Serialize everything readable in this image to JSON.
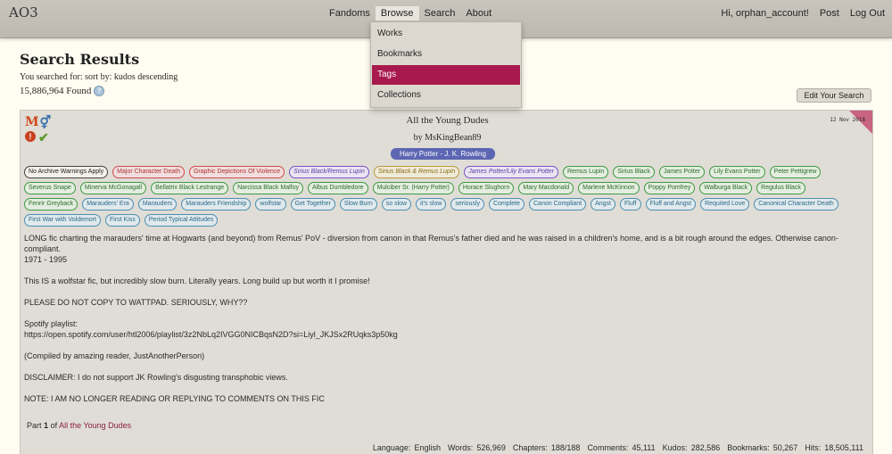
{
  "header": {
    "logo": "AO3",
    "nav": [
      "Fandoms",
      "Browse",
      "Search",
      "About"
    ],
    "user_nav": [
      "Hi, orphan_account!",
      "Post",
      "Log Out"
    ]
  },
  "browse_menu": [
    "Works",
    "Bookmarks",
    "Tags",
    "Collections"
  ],
  "search": {
    "title": "Search Results",
    "description": "You searched for: sort by: kudos descending",
    "found": "15,886,964 Found",
    "help": "?",
    "edit_button": "Edit Your Search"
  },
  "work": {
    "title": "All the Young Dudes",
    "byline": "by MsKingBean89",
    "fandom": "Harry Potter - J. K. Rowling",
    "date": "12 Nov 2018",
    "rating_symbols": [
      "M",
      "⚥",
      "!",
      "✔"
    ],
    "tags": [
      {
        "label": "No Archive Warnings Apply",
        "type": "warning"
      },
      {
        "label": "Major Character Death",
        "type": "category"
      },
      {
        "label": "Graphic Depictions Of Violence",
        "type": "category"
      },
      {
        "label": "Sirius Black/Remus Lupin",
        "type": "rel1"
      },
      {
        "label": "Sirius Black & Remus Lupin",
        "type": "rel2"
      },
      {
        "label": "James Potter/Lily Evans Potter",
        "type": "rel1"
      },
      {
        "label": "Remus Lupin",
        "type": "char"
      },
      {
        "label": "Sirius Black",
        "type": "char"
      },
      {
        "label": "James Potter",
        "type": "char"
      },
      {
        "label": "Lily Evans Potter",
        "type": "char"
      },
      {
        "label": "Peter Pettigrew",
        "type": "char"
      },
      {
        "label": "Severus Snape",
        "type": "char"
      },
      {
        "label": "Minerva McGonagall",
        "type": "char"
      },
      {
        "label": "Bellatrix Black Lestrange",
        "type": "char"
      },
      {
        "label": "Narcissa Black Malfoy",
        "type": "char"
      },
      {
        "label": "Albus Dumbledore",
        "type": "char"
      },
      {
        "label": "Mulciber Sr. (Harry Potter)",
        "type": "char"
      },
      {
        "label": "Horace Slughorn",
        "type": "char"
      },
      {
        "label": "Mary Macdonald",
        "type": "char"
      },
      {
        "label": "Marlene McKinnon",
        "type": "char"
      },
      {
        "label": "Poppy Pomfrey",
        "type": "char"
      },
      {
        "label": "Walburga Black",
        "type": "char"
      },
      {
        "label": "Regulus Black",
        "type": "char"
      },
      {
        "label": "Fenrir Greyback",
        "type": "char"
      },
      {
        "label": "Marauders' Era",
        "type": "freeform"
      },
      {
        "label": "Marauders",
        "type": "freeform"
      },
      {
        "label": "Marauders Friendship",
        "type": "freeform"
      },
      {
        "label": "wolfstar",
        "type": "freeform"
      },
      {
        "label": "Get Together",
        "type": "freeform"
      },
      {
        "label": "Slow Burn",
        "type": "freeform"
      },
      {
        "label": "so slow",
        "type": "freeform"
      },
      {
        "label": "it's slow",
        "type": "freeform"
      },
      {
        "label": "seriously",
        "type": "freeform"
      },
      {
        "label": "Complete",
        "type": "freeform"
      },
      {
        "label": "Canon Compliant",
        "type": "freeform"
      },
      {
        "label": "Angst",
        "type": "freeform"
      },
      {
        "label": "Fluff",
        "type": "freeform"
      },
      {
        "label": "Fluff and Angst",
        "type": "freeform"
      },
      {
        "label": "Requited Love",
        "type": "freeform"
      },
      {
        "label": "Canonical Character Death",
        "type": "freeform"
      },
      {
        "label": "First War with Voldemort",
        "type": "freeform"
      },
      {
        "label": "First Kiss",
        "type": "freeform"
      },
      {
        "label": "Period Typical Attitudes",
        "type": "freeform"
      }
    ],
    "summary": [
      "LONG fic charting the marauders' time at Hogwarts (and beyond) from Remus' PoV - diversion from canon in that Remus's father died and he was raised in a children's home, and is a bit rough around the edges. Otherwise canon-compliant.\n1971 - 1995",
      "This IS a wolfstar fic, but incredibly slow burn. Literally years. Long build up but worth it I promise!",
      "PLEASE DO NOT COPY TO WATTPAD. SERIOUSLY, WHY??",
      "Spotify playlist:\nhttps://open.spotify.com/user/htl2006/playlist/3z2NbLq2IVGG0NICBqsN2D?si=Liyl_JKJSx2RUqks3p50kg",
      "(Compiled by amazing reader, JustAnotherPerson)",
      " DISCLAIMER: I do not support JK Rowling's disgusting transphobic views.",
      "NOTE: I AM NO LONGER READING OR REPLYING TO COMMENTS ON THIS FIC"
    ],
    "series": {
      "prefix": "Part",
      "part": "1",
      "of": "of",
      "name": "All the Young Dudes"
    },
    "stats": [
      {
        "label": "Language:",
        "value": "English"
      },
      {
        "label": "Words:",
        "value": "526,969"
      },
      {
        "label": "Chapters:",
        "value": "188/188"
      },
      {
        "label": "Comments:",
        "value": "45,111"
      },
      {
        "label": "Kudos:",
        "value": "282,586"
      },
      {
        "label": "Bookmarks:",
        "value": "50,267"
      },
      {
        "label": "Hits:",
        "value": "18,505,111"
      }
    ]
  },
  "colors": {
    "accent": "#a81a4d",
    "fandom_badge": "#5c66b2"
  }
}
